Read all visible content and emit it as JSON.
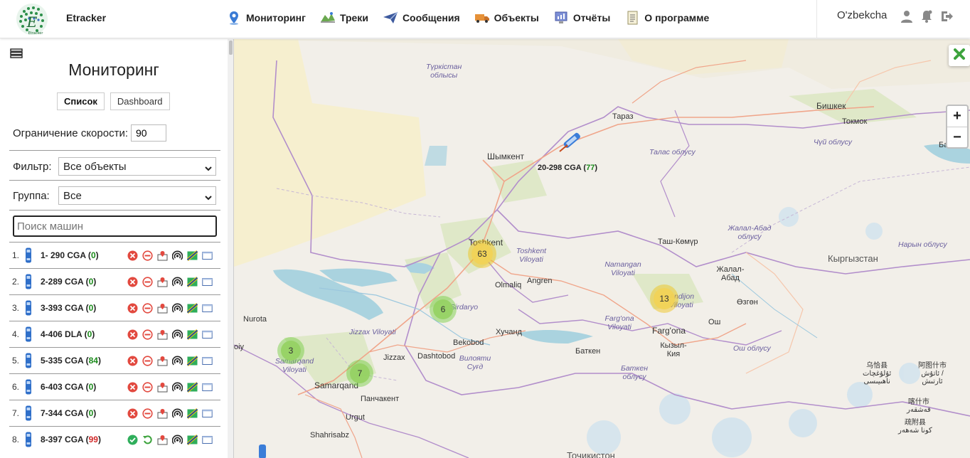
{
  "header": {
    "brand": "Etracker",
    "logo_text": "Etracker",
    "nav": [
      {
        "label": "Мониторинг",
        "icon": "map-pin-icon"
      },
      {
        "label": "Треки",
        "icon": "tracks-icon"
      },
      {
        "label": "Сообщения",
        "icon": "send-icon"
      },
      {
        "label": "Объекты",
        "icon": "truck-icon"
      },
      {
        "label": "Отчёты",
        "icon": "report-icon"
      },
      {
        "label": "О программе",
        "icon": "document-icon"
      }
    ],
    "language": "O'zbekcha"
  },
  "sidebar": {
    "title": "Мониторинг",
    "view_list": "Список",
    "view_dashboard": "Dashboard",
    "speed_label": "Ограничение скорости:",
    "speed_value": "90",
    "filter_label": "Фильтр:",
    "filter_value": "Все объекты",
    "group_label": "Группа:",
    "group_value": "Все",
    "search_placeholder": "Поиск машин",
    "vehicles": [
      {
        "num": "1.",
        "name": "1- 290 CGA",
        "speed": "0",
        "online": false
      },
      {
        "num": "2.",
        "name": "2-289 CGA",
        "speed": "0",
        "online": false
      },
      {
        "num": "3.",
        "name": "3-393 CGA",
        "speed": "0",
        "online": false
      },
      {
        "num": "4.",
        "name": "4-406 DLA",
        "speed": "0",
        "online": false
      },
      {
        "num": "5.",
        "name": "5-335 CGA",
        "speed": "84",
        "online": false
      },
      {
        "num": "6.",
        "name": "6-403 CGA",
        "speed": "0",
        "online": false
      },
      {
        "num": "7.",
        "name": "7-344 CGA",
        "speed": "0",
        "online": false
      },
      {
        "num": "8.",
        "name": "8-397 CGA",
        "speed": "99",
        "online": true
      }
    ]
  },
  "map": {
    "vehicle_label": "20-298 CGA",
    "vehicle_speed": "77",
    "clusters": [
      {
        "count": "63",
        "color": "yellow"
      },
      {
        "count": "13",
        "color": "yellow"
      },
      {
        "count": "6",
        "color": "green"
      },
      {
        "count": "3",
        "color": "green"
      },
      {
        "count": "7",
        "color": "green"
      }
    ],
    "labels": {
      "turkistan": "Түркістан\nоблысы",
      "taraz": "Тараз",
      "bishkek": "Бишкек",
      "tokmok": "Токмок",
      "balykchy": "Балыкч",
      "shymkent": "Шымкент",
      "talas": "Талас облусу",
      "chuy": "Чүй облусу",
      "jalalabad_reg": "Жалал-Абад облусу",
      "naryn": "Нарын облусу",
      "kyrgyzstan": "Кыргызстан",
      "toshkent": "Toshkent",
      "toshkent_vil": "Toshkent Viloyati",
      "tashkomur": "Таш-Көмүр",
      "namangan": "Namangan Viloyati",
      "jalalabad": "Жалал-Абад",
      "olmaliq": "Olmaliq",
      "angren": "Angren",
      "andijon": "Andijon Viloyati",
      "ozgon": "Өзгөн",
      "sirdaryo": "Sirdaryo",
      "nurota": "Nurota",
      "jizzax_vil": "Jizzax Viloyati",
      "khujand": "Хучанд",
      "fargona_vil": "Farg'ona Viloyati",
      "osh": "Ош",
      "fargona": "Farg'ona",
      "bekobod": "Bekobod",
      "batken": "Баткен",
      "kyzylkiya": "Кызыл-Кия",
      "osh_reg": "Ош облусу",
      "jizzax": "Jizzax",
      "dashtobod": "Dashtobod",
      "sughd": "Вилояти Суғд",
      "batken_reg": "Баткен облусу",
      "samarqand_vil": "Samarqand Viloyati",
      "samarqand": "Samarqand",
      "panjakent": "Панчакент",
      "urgut": "Urgut",
      "shahrisabz": "Shahrisabz",
      "tajikistan": "Тоҷикистон",
      "ulugqat": "乌恰县\nئۇلۇغچات\nناھىيىسى",
      "artux": "阿图什市\nئاتۇش /\nئارتىش",
      "kashgar": "喀什市\nقەشقەر",
      "shufu": "疏附县\nكونا شەھەر",
      "qoy": "oiy"
    }
  },
  "colors": {
    "accent_green": "#1b8a1b",
    "danger_red": "#d12a2a",
    "cluster_yellow": "#f1d357",
    "cluster_green": "#96d264"
  }
}
